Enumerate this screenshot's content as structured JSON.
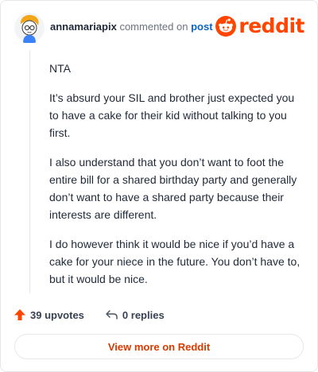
{
  "header": {
    "username": "annamariapix",
    "action_text": "commented on",
    "target_link": "post",
    "logo_text": "reddit"
  },
  "comment": {
    "paragraphs": [
      "NTA",
      "It’s absurd your SIL and brother just expected you to have a cake for their kid without talking to you first.",
      "I also understand that you don’t want to foot the entire bill for a shared birthday party and generally don’t want to have a shared party because their interests are different.",
      "I do however think it would be nice if you’d have a cake for your niece in the future. You don’t have to, but it would be nice."
    ]
  },
  "actions": {
    "upvotes_label": "39 upvotes",
    "replies_label": "0 replies"
  },
  "footer": {
    "view_more_label": "View more on Reddit"
  },
  "colors": {
    "brand": "#ff4500",
    "link": "#0a66c2",
    "view_more": "#d93a00"
  },
  "icons": [
    "avatar",
    "reddit-logo-icon",
    "upvote-arrow-icon",
    "reply-icon"
  ]
}
